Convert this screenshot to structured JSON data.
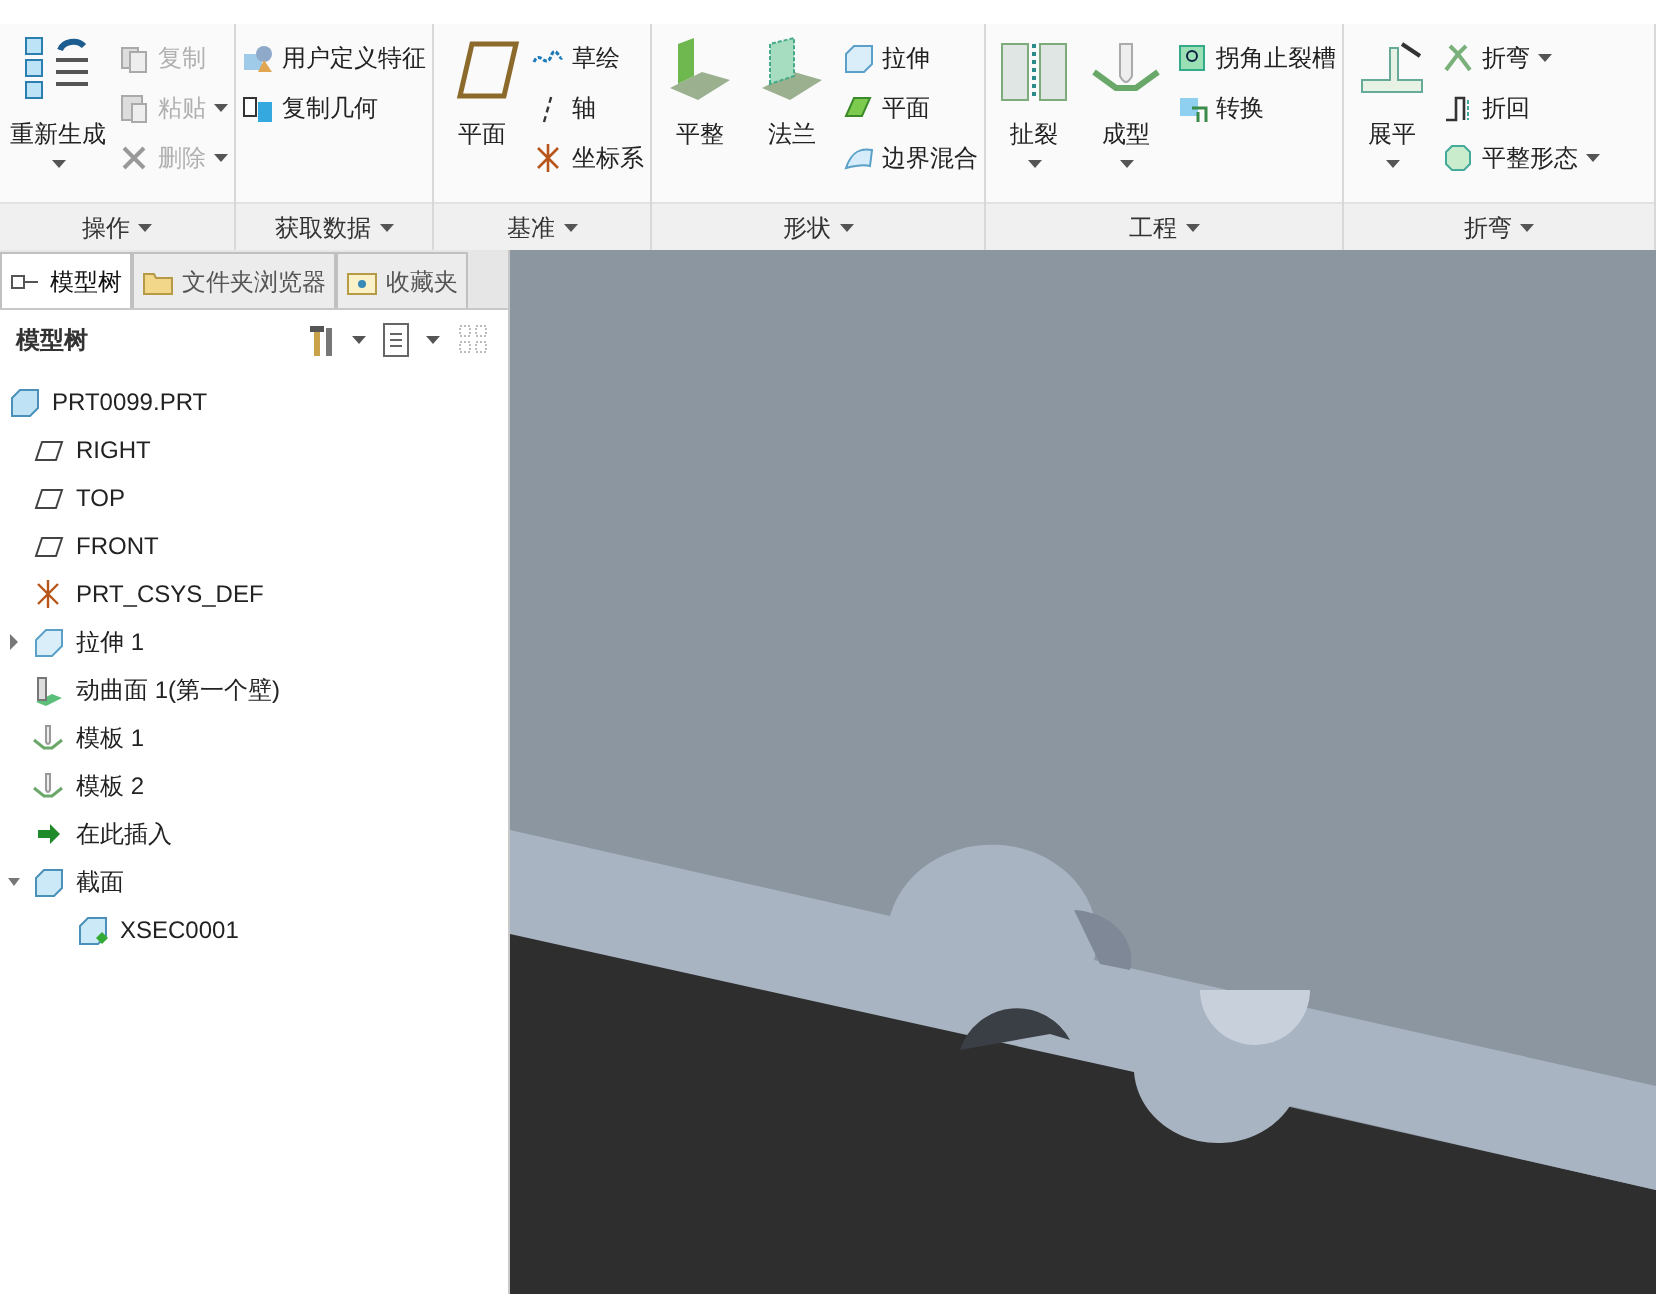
{
  "ribbon": {
    "groups": [
      {
        "label": "操作",
        "items": [
          {
            "kind": "large",
            "label": "重新生成",
            "dropdown": true
          },
          {
            "kind": "column",
            "items": [
              {
                "label": "复制",
                "disabled": true
              },
              {
                "label": "粘贴",
                "dropdown": true,
                "disabled": true
              },
              {
                "label": "删除",
                "dropdown": true,
                "disabled": true
              }
            ]
          }
        ]
      },
      {
        "label": "获取数据",
        "items": [
          {
            "kind": "column",
            "items": [
              {
                "label": "用户定义特征"
              },
              {
                "label": "复制几何"
              }
            ]
          }
        ]
      },
      {
        "label": "基准",
        "items": [
          {
            "kind": "large",
            "label": "平面"
          },
          {
            "kind": "column",
            "items": [
              {
                "label": "草绘"
              },
              {
                "label": "轴"
              },
              {
                "label": "坐标系"
              }
            ]
          }
        ]
      },
      {
        "label": "形状",
        "items": [
          {
            "kind": "large",
            "label": "平整"
          },
          {
            "kind": "large",
            "label": "法兰"
          },
          {
            "kind": "column",
            "items": [
              {
                "label": "拉伸"
              },
              {
                "label": "平面"
              },
              {
                "label": "边界混合"
              }
            ]
          }
        ]
      },
      {
        "label": "工程",
        "items": [
          {
            "kind": "large",
            "label": "扯裂",
            "dropdown": true
          },
          {
            "kind": "large",
            "label": "成型",
            "dropdown": true
          },
          {
            "kind": "column",
            "items": [
              {
                "label": "拐角止裂槽"
              },
              {
                "label": "转换"
              }
            ]
          }
        ]
      },
      {
        "label": "折弯",
        "items": [
          {
            "kind": "large",
            "label": "展平",
            "dropdown": true
          },
          {
            "kind": "column",
            "items": [
              {
                "label": "折弯",
                "dropdown": true
              },
              {
                "label": "折回"
              },
              {
                "label": "平整形态",
                "dropdown": true
              }
            ]
          }
        ]
      }
    ]
  },
  "panel": {
    "tabs": [
      {
        "label": "模型树",
        "selected": true
      },
      {
        "label": "文件夹浏览器",
        "selected": false
      },
      {
        "label": "收藏夹",
        "selected": false
      }
    ],
    "title": "模型树",
    "tree": [
      {
        "kind": "part",
        "label": "PRT0099.PRT",
        "children": [
          {
            "kind": "plane",
            "label": "RIGHT"
          },
          {
            "kind": "plane",
            "label": "TOP"
          },
          {
            "kind": "plane",
            "label": "FRONT"
          },
          {
            "kind": "csys",
            "label": "PRT_CSYS_DEF"
          },
          {
            "kind": "extrude",
            "label": "拉伸 1",
            "expanded": false
          },
          {
            "kind": "wall",
            "label": "动曲面 1(第一个壁)"
          },
          {
            "kind": "form",
            "label": "模板 1"
          },
          {
            "kind": "form",
            "label": "模板 2"
          },
          {
            "kind": "insert",
            "label": "在此插入"
          },
          {
            "kind": "section",
            "label": "截面",
            "expanded": true,
            "children": [
              {
                "kind": "xsec",
                "label": "XSEC0001"
              }
            ]
          }
        ]
      }
    ]
  }
}
